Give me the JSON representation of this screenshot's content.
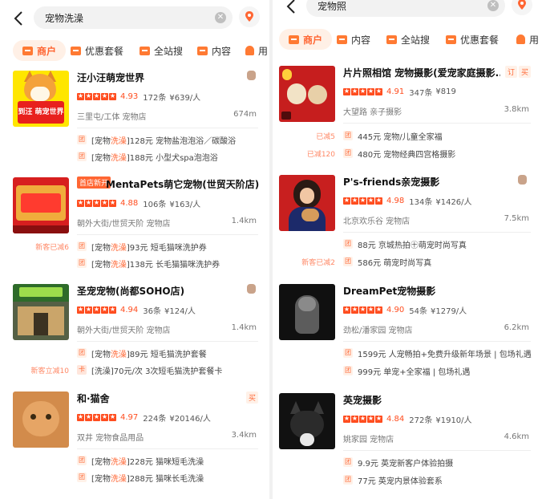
{
  "left": {
    "search": {
      "query": "宠物洗澡",
      "clear": "✕"
    },
    "tabs": [
      {
        "label": "商户",
        "active": true
      },
      {
        "label": "优惠套餐"
      },
      {
        "label": "全站搜"
      },
      {
        "label": "内容"
      },
      {
        "label": "用"
      }
    ],
    "shops": [
      {
        "name": "汪小汪萌宠世界",
        "score": "4.93",
        "reviews": "172条",
        "price": "¥639/人",
        "meta": "三里屯/工体  宠物店",
        "distance": "674m",
        "image_text": "到汪 萌宠世界",
        "deals": [
          {
            "icon": "团",
            "before": "[宠物",
            "hl": "洗澡",
            "after": "]128元 宠物盐泡泡浴／碳酸浴"
          },
          {
            "icon": "团",
            "before": "[宠物",
            "hl": "洗澡",
            "after": "]188元 小型犬spa泡泡浴"
          }
        ]
      },
      {
        "name": "MentaPets萌它宠物(世贸天阶店)",
        "new_tag": "首店新开",
        "score": "4.88",
        "reviews": "106条",
        "price": "¥163/人",
        "meta": "朝外大街/世贸天阶  宠物店",
        "distance": "1.4km",
        "side_tag": "新客已减6",
        "deals": [
          {
            "icon": "团",
            "before": "[宠物",
            "hl": "洗澡",
            "after": "]93元 短毛猫咪洗护券"
          },
          {
            "icon": "团",
            "before": "[宠物",
            "hl": "洗澡",
            "after": "]138元 长毛猫猫咪洗护券"
          }
        ]
      },
      {
        "name": "圣宠宠物(尚都SOHO店)",
        "score": "4.94",
        "reviews": "36条",
        "price": "¥124/人",
        "meta": "朝外大街/世贸天阶  宠物店",
        "distance": "1.4km",
        "side_tag": "新客立减10",
        "deals": [
          {
            "icon": "团",
            "before": "[宠物",
            "hl": "洗澡",
            "after": "]89元 短毛猫洗护套餐"
          },
          {
            "icon": "卡",
            "before": "[洗澡]70元/次 3次短毛猫洗护套餐卡",
            "hl": "",
            "after": ""
          }
        ]
      },
      {
        "name": "和·猫舍",
        "corner": "买",
        "score": "4.97",
        "reviews": "224条",
        "price": "¥20146/人",
        "meta": "双井  宠物食品用品",
        "distance": "3.4km",
        "deals": [
          {
            "icon": "团",
            "before": "[宠物",
            "hl": "洗澡",
            "after": "]228元 猫咪短毛洗澡"
          },
          {
            "icon": "团",
            "before": "[宠物",
            "hl": "洗澡",
            "after": "]288元 猫咪长毛洗澡"
          }
        ]
      }
    ]
  },
  "right": {
    "search": {
      "query": "宠物照",
      "clear": "✕"
    },
    "tabs": [
      {
        "label": "商户",
        "active": true
      },
      {
        "label": "内容"
      },
      {
        "label": "全站搜"
      },
      {
        "label": "优惠套餐"
      },
      {
        "label": "用"
      }
    ],
    "shops": [
      {
        "name": "片片照相馆 宠物摄影(爱宠家庭摄影...",
        "corners": [
          "订",
          "买"
        ],
        "score": "4.91",
        "reviews": "347条",
        "price": "¥819",
        "meta": "大望路  亲子摄影",
        "distance": "3.8km",
        "deals": [
          {
            "icon": "团",
            "text": "445元 宠物/儿童全家福",
            "side": "已减5"
          },
          {
            "icon": "团",
            "text": "480元 宠物经典四宫格摄影",
            "side": "已减120"
          }
        ]
      },
      {
        "name": "P's-friends亲宠摄影",
        "score": "4.98",
        "reviews": "134条",
        "price": "¥1426/人",
        "meta": "北京欢乐谷  宠物店",
        "distance": "7.5km",
        "deals": [
          {
            "icon": "团",
            "text": "88元 京城热拍㊉萌宠时尚写真",
            "side": ""
          },
          {
            "icon": "团",
            "text": "586元 萌宠时尚写真",
            "side": "新客已减2"
          }
        ]
      },
      {
        "name": "DreamPet宠物摄影",
        "score": "4.90",
        "reviews": "54条",
        "price": "¥1279/人",
        "meta": "劲松/潘家园  宠物店",
        "distance": "6.2km",
        "deals": [
          {
            "icon": "团",
            "text": "1599元 人宠畅拍+免费升级新年场景 | 包场礼遇",
            "side": ""
          },
          {
            "icon": "团",
            "text": "999元 单宠+全家福 | 包场礼遇",
            "side": ""
          }
        ]
      },
      {
        "name": "英宠摄影",
        "score": "4.84",
        "reviews": "272条",
        "price": "¥1910/人",
        "meta": "姚家园  宠物店",
        "distance": "4.6km",
        "deals": [
          {
            "icon": "团",
            "text": "9.9元 英宠新客户体验拍摄",
            "side": ""
          },
          {
            "icon": "团",
            "text": "77元 英宠内景体验套系",
            "side": ""
          }
        ]
      }
    ]
  },
  "colors": {
    "accent": "#ff6633",
    "star": "#ff4d1f",
    "tab_bg": "#fff0e6"
  }
}
